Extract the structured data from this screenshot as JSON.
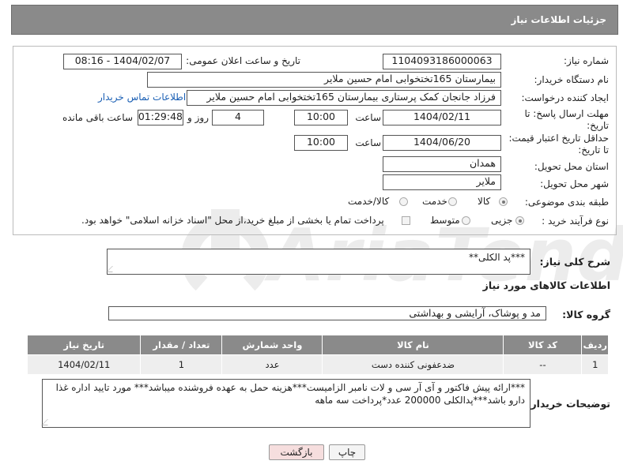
{
  "header": {
    "title": "جزئیات اطلاعات نیاز"
  },
  "form": {
    "need_number_label": "شماره نیاز:",
    "need_number": "1104093186000063",
    "announce_label": "تاریخ و ساعت اعلان عمومی:",
    "announce_value": "1404/02/07 - 08:16",
    "buyer_label": "نام دستگاه خریدار:",
    "buyer_value": "بیمارستان 165تختخوابی امام حسین ملایر",
    "creator_label": "ایجاد کننده درخواست:",
    "creator_value": "فرزاد جانجان کمک پرستاری بیمارستان 165تختخوابی امام حسین ملایر",
    "contact_link": "اطلاعات تماس خریدار",
    "deadline_label": "مهلت ارسال پاسخ: تا تاریخ:",
    "deadline_date": "1404/02/11",
    "time_label": "ساعت",
    "deadline_time": "10:00",
    "days_value": "4",
    "days_label": "روز و",
    "remaining_value": "01:29:48",
    "remaining_label": "ساعت باقی مانده",
    "price_valid_label": "حداقل تاریخ اعتبار قیمت: تا تاریخ:",
    "price_valid_date": "1404/06/20",
    "price_valid_time": "10:00",
    "province_label": "استان محل تحویل:",
    "province_value": "همدان",
    "city_label": "شهر محل تحویل:",
    "city_value": "ملایر",
    "category_label": "طبقه بندی موضوعی:",
    "category_options": [
      "کالا",
      "خدمت",
      "کالا/خدمت"
    ],
    "category_selected": "کالا",
    "process_label": "نوع فرآیند خرید :",
    "process_options": [
      "جزیی",
      "متوسط"
    ],
    "process_selected": "جزیی",
    "payment_note": "پرداخت تمام یا بخشی از مبلغ خرید،از محل \"اسناد خزانه اسلامی\" خواهد بود."
  },
  "description": {
    "label": "شرح کلی نیاز:",
    "value": "***پد الکلی**"
  },
  "goods": {
    "section_title": "اطلاعات کالاهای مورد نیاز",
    "group_label": "گروه کالا:",
    "group_value": "مد و پوشاک، آرایشی و بهداشتی",
    "columns": [
      "ردیف",
      "کد کالا",
      "نام کالا",
      "واحد شمارش",
      "تعداد / مقدار",
      "تاریخ نیاز"
    ],
    "rows": [
      {
        "row": "1",
        "code": "--",
        "name": "ضدعفونی کننده دست",
        "unit": "عدد",
        "qty": "1",
        "date": "1404/02/11"
      }
    ]
  },
  "buyer_notes": {
    "label": "توضیحات خریدار:",
    "value": "***ارائه پیش فاکتور و آی آر سی و لات نامبر الزامیست***هزینه حمل به عهده فروشنده میباشد*** مورد تایید اداره غذا دارو باشد***پدالکلی 200000 عدد*پرداخت سه ماهه"
  },
  "buttons": {
    "print": "چاپ",
    "back": "بازگشت"
  },
  "watermark": {
    "text": "AriaTender.net"
  },
  "colors": {
    "header_bg": "#8a8a8a",
    "link": "#1a5fb4",
    "back_button_bg": "#f6dede"
  }
}
